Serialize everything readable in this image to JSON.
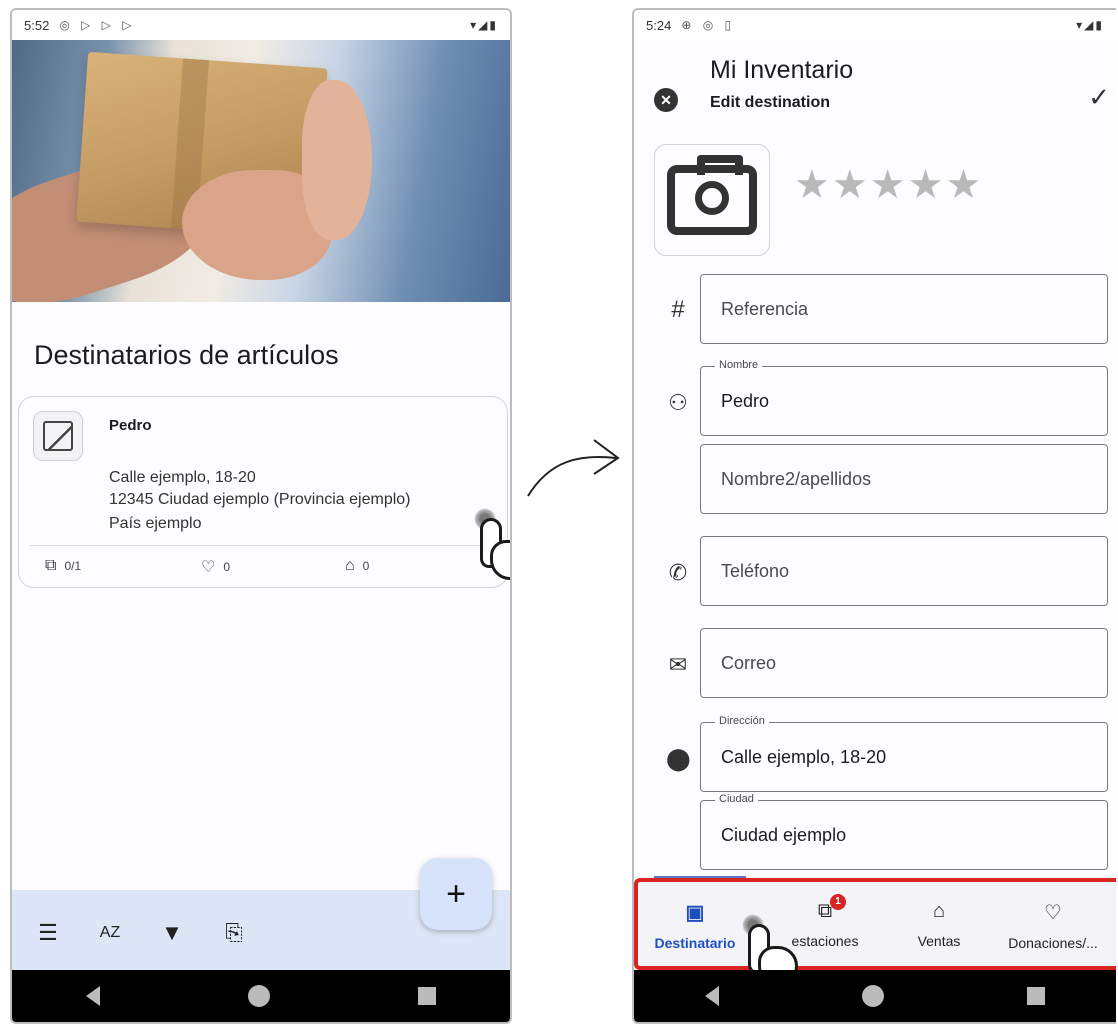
{
  "left": {
    "status": {
      "time": "5:52",
      "icons": "◎ ▷ ▷ ▷",
      "right": "▾◢▮"
    },
    "page_title": "Destinatarios de artículos",
    "card": {
      "name": "Pedro",
      "address1": "Calle ejemplo, 18-20",
      "address2": "12345 Ciudad ejemplo (Provincia ejemplo)",
      "address3": "País ejemplo",
      "stats": [
        {
          "icon": "loans-icon",
          "value": "0/1"
        },
        {
          "icon": "donations-icon",
          "value": "0"
        },
        {
          "icon": "sales-icon",
          "value": "0"
        }
      ]
    },
    "toolbar": {
      "menu": "☰",
      "sort": "AZ",
      "filter": "▼",
      "export": "⎘"
    },
    "fab": "+"
  },
  "right": {
    "status": {
      "time": "5:24",
      "icons": "⊕ ◎ ▯",
      "right": "▾◢▮"
    },
    "appbar": {
      "title": "Mi Inventario",
      "subtitle": "Edit destination",
      "close": "✕",
      "confirm": "✓"
    },
    "stars": "★★★★★",
    "form": {
      "reference": {
        "placeholder": "Referencia",
        "icon": "#"
      },
      "name": {
        "label": "Nombre",
        "value": "Pedro"
      },
      "surname": {
        "placeholder": "Nombre2/apellidos"
      },
      "phone": {
        "placeholder": "Teléfono"
      },
      "email": {
        "placeholder": "Correo"
      },
      "address": {
        "label": "Dirección",
        "value": "Calle ejemplo, 18-20"
      },
      "city": {
        "label": "Ciudad",
        "value": "Ciudad ejemplo"
      }
    },
    "bottom_nav": [
      {
        "label": "Destinatario",
        "icon": "contact-card-icon",
        "active": true
      },
      {
        "label": "estaciones",
        "icon": "loans-icon",
        "badge": "1"
      },
      {
        "label": "Ventas",
        "icon": "shopping-bag-icon"
      },
      {
        "label": "Donaciones/...",
        "icon": "hand-heart-icon"
      }
    ]
  }
}
